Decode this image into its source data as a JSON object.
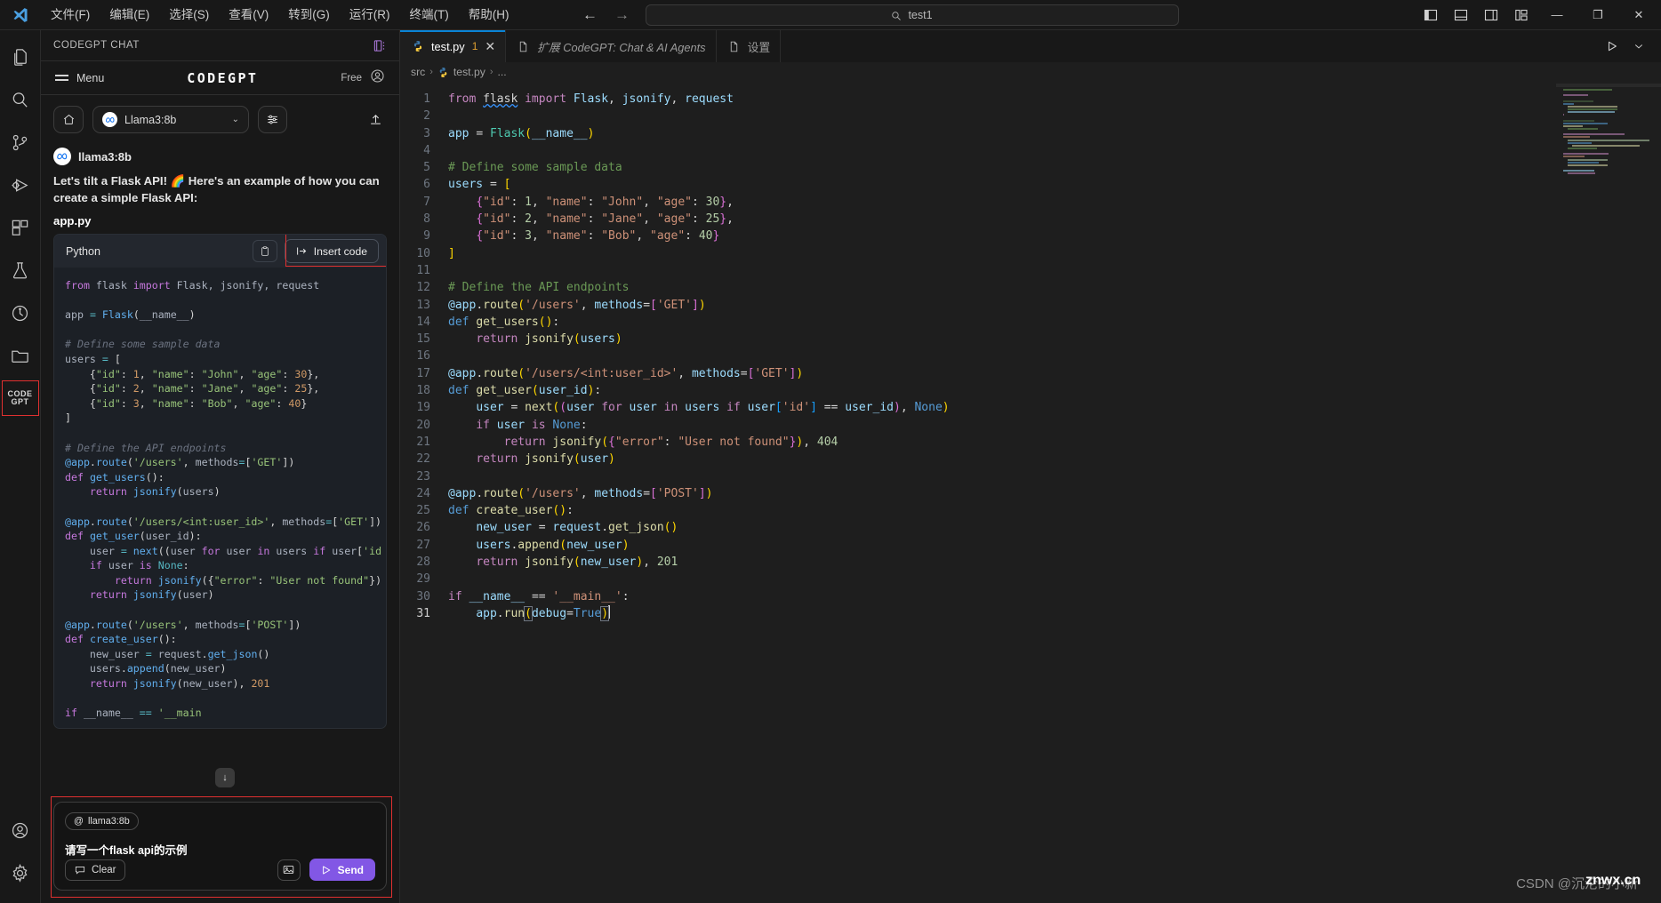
{
  "titlebar": {
    "logo_icon": "vscode-logo",
    "menus": [
      {
        "label": "文件(F)"
      },
      {
        "label": "编辑(E)"
      },
      {
        "label": "选择(S)"
      },
      {
        "label": "查看(V)"
      },
      {
        "label": "转到(G)"
      },
      {
        "label": "运行(R)"
      },
      {
        "label": "终端(T)"
      },
      {
        "label": "帮助(H)"
      }
    ],
    "nav_back": "←",
    "nav_forward": "→",
    "search": {
      "icon": "search-icon",
      "value": "test1"
    },
    "layout_buttons": [
      {
        "name": "toggle-primary-sidebar",
        "label": "▮▯"
      },
      {
        "name": "toggle-panel",
        "label": "▤"
      },
      {
        "name": "toggle-secondary-sidebar",
        "label": "▯▮"
      },
      {
        "name": "customize-layout",
        "label": "▥"
      }
    ],
    "window_controls": [
      {
        "name": "minimize-button",
        "label": "—"
      },
      {
        "name": "restore-button",
        "label": "❐"
      },
      {
        "name": "close-button",
        "label": "✕"
      }
    ]
  },
  "activitybar": {
    "items": [
      {
        "name": "explorer",
        "icon": "files-icon"
      },
      {
        "name": "search",
        "icon": "search-icon"
      },
      {
        "name": "source-control",
        "icon": "source-control-icon"
      },
      {
        "name": "run-and-debug",
        "icon": "run-debug-icon"
      },
      {
        "name": "extensions",
        "icon": "extensions-icon"
      },
      {
        "name": "testing",
        "icon": "beaker-icon"
      },
      {
        "name": "timeline",
        "icon": "clock-history-icon"
      },
      {
        "name": "remote-explorer",
        "icon": "folder-icon"
      }
    ],
    "codegpt": {
      "line1": "CODE",
      "line2": "GPT",
      "selected": true,
      "highlight_color": "#e03030"
    },
    "bottom": [
      {
        "name": "accounts",
        "icon": "account-icon"
      },
      {
        "name": "manage",
        "icon": "gear-icon"
      }
    ]
  },
  "sidepanel": {
    "title": "CODEGPT CHAT",
    "header_action_icon": "notebook-more-icon",
    "topbar": {
      "menu_label": "Menu",
      "brand": "CODEGPT",
      "plan": "Free",
      "account_icon": "account-icon"
    },
    "controls": {
      "home_icon": "home-icon",
      "model": "Llama3:8b",
      "model_avatar_icon": "meta-icon",
      "chevron_icon": "chevron-down-icon",
      "settings_icon": "sliders-icon",
      "upload_icon": "upload-icon"
    },
    "message": {
      "author": "llama3:8b",
      "author_avatar_icon": "meta-icon",
      "text": "Let's tilt a Flask API! 🌈 Here's an example of how you can create a simple Flask API:",
      "filename": "app.py"
    },
    "code_block": {
      "language": "Python",
      "copy_icon": "clipboard-icon",
      "insert_label": "Insert code",
      "insert_icon": "insert-arrow-icon",
      "highlight_color": "#e03030"
    },
    "scroll_down_icon": "arrow-down-icon",
    "input": {
      "mention_icon": "at-icon",
      "mention": "llama3:8b",
      "value": "请写一个flask api的示例",
      "clear_label": "Clear",
      "clear_icon": "comment-icon",
      "image_icon": "image-icon",
      "send_label": "Send",
      "send_icon": "send-icon",
      "send_color": "#8257e5",
      "highlight_color": "#e03030"
    }
  },
  "editor": {
    "tabs": [
      {
        "label": "test.py",
        "icon": "python-icon",
        "badge": "1",
        "close": "✕",
        "active": true,
        "italic": false
      },
      {
        "label": "扩展 CodeGPT: Chat & AI Agents",
        "icon": "file-icon",
        "badge": "",
        "close": "",
        "active": false,
        "italic": true
      },
      {
        "label": "设置",
        "icon": "file-icon",
        "badge": "",
        "close": "",
        "active": false,
        "italic": false
      }
    ],
    "tabbar_actions": [
      {
        "name": "run-python-file-button",
        "icon": "play-icon",
        "label": "▷"
      },
      {
        "name": "split-editor-button",
        "icon": "chevron-down-icon",
        "label": "⌄"
      }
    ],
    "breadcrumb": [
      "src",
      "test.py",
      "..."
    ],
    "breadcrumb_sep": ">",
    "breadcrumb_file_icon": "python-icon",
    "line_count": 31,
    "cursor_line": 31,
    "code_lines": [
      "from flask import Flask, jsonify, request",
      "",
      "app = Flask(__name__)",
      "",
      "# Define some sample data",
      "users = [",
      "    {\"id\": 1, \"name\": \"John\", \"age\": 30},",
      "    {\"id\": 2, \"name\": \"Jane\", \"age\": 25},",
      "    {\"id\": 3, \"name\": \"Bob\", \"age\": 40}",
      "]",
      "",
      "# Define the API endpoints",
      "@app.route('/users', methods=['GET'])",
      "def get_users():",
      "    return jsonify(users)",
      "",
      "@app.route('/users/<int:user_id>', methods=['GET'])",
      "def get_user(user_id):",
      "    user = next((user for user in users if user['id'] == user_id), None)",
      "    if user is None:",
      "        return jsonify({\"error\": \"User not found\"}), 404",
      "    return jsonify(user)",
      "",
      "@app.route('/users', methods=['POST'])",
      "def create_user():",
      "    new_user = request.get_json()",
      "    users.append(new_user)",
      "    return jsonify(new_user), 201",
      "",
      "if __name__ == '__main__':",
      "    app.run(debug=True)"
    ]
  },
  "sidepanel_code_lines": [
    "from flask import Flask, jsonify, request",
    "",
    "app = Flask(__name__)",
    "",
    "# Define some sample data",
    "users = [",
    "    {\"id\": 1, \"name\": \"John\", \"age\": 30},",
    "    {\"id\": 2, \"name\": \"Jane\", \"age\": 25},",
    "    {\"id\": 3, \"name\": \"Bob\", \"age\": 40}",
    "]",
    "",
    "# Define the API endpoints",
    "@app.route('/users', methods=['GET'])",
    "def get_users():",
    "    return jsonify(users)",
    "",
    "@app.route('/users/<int:user_id>', methods=['GET'])",
    "def get_user(user_id):",
    "    user = next((user for user in users if user['id",
    "    if user is None:",
    "        return jsonify({\"error\": \"User not found\"})",
    "    return jsonify(user)",
    "",
    "@app.route('/users', methods=['POST'])",
    "def create_user():",
    "    new_user = request.get_json()",
    "    users.append(new_user)",
    "    return jsonify(new_user), 201",
    "",
    "if __name__ == '__main'"
  ],
  "watermark": {
    "text": "CSDN @沉沦的小新",
    "overlay": "znwx.cn"
  }
}
